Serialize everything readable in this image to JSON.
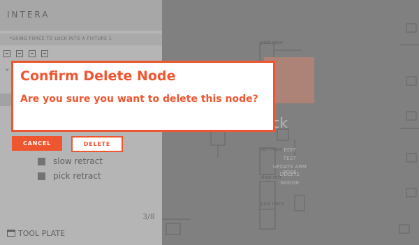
{
  "app": {
    "brand": "INTERA",
    "subtitle": "*USING FORCE TO LOCK INTO A FIXTURE 1"
  },
  "toolbar": {
    "icons": [
      "list-icon",
      "list-down-icon",
      "refresh-icon",
      "list-up-icon"
    ]
  },
  "left_list": {
    "partial_item": "t r",
    "items": [
      {
        "label": "slow retract",
        "icon": "square-icon"
      },
      {
        "label": "pick retract",
        "icon": "square-icon"
      }
    ],
    "pager": "3/8",
    "footer_label": "TOOL PLATE"
  },
  "canvas": {
    "selected_node_label": "ick",
    "context_menu": [
      "EDIT",
      "TEST",
      "UPDATE ARM POSE",
      "DELETE",
      "NUDGE"
    ],
    "node_labels": [
      "pick appr",
      "set mass",
      "slow retr",
      "pick retra"
    ]
  },
  "dialog": {
    "title": "Confirm Delete Node",
    "message": "Are you sure you want to delete this node?",
    "cancel_label": "CANCEL",
    "delete_label": "DELETE"
  },
  "colors": {
    "accent": "#ee5630",
    "peach": "#f3a58f",
    "canvas_bg": "#9e9e9e"
  }
}
